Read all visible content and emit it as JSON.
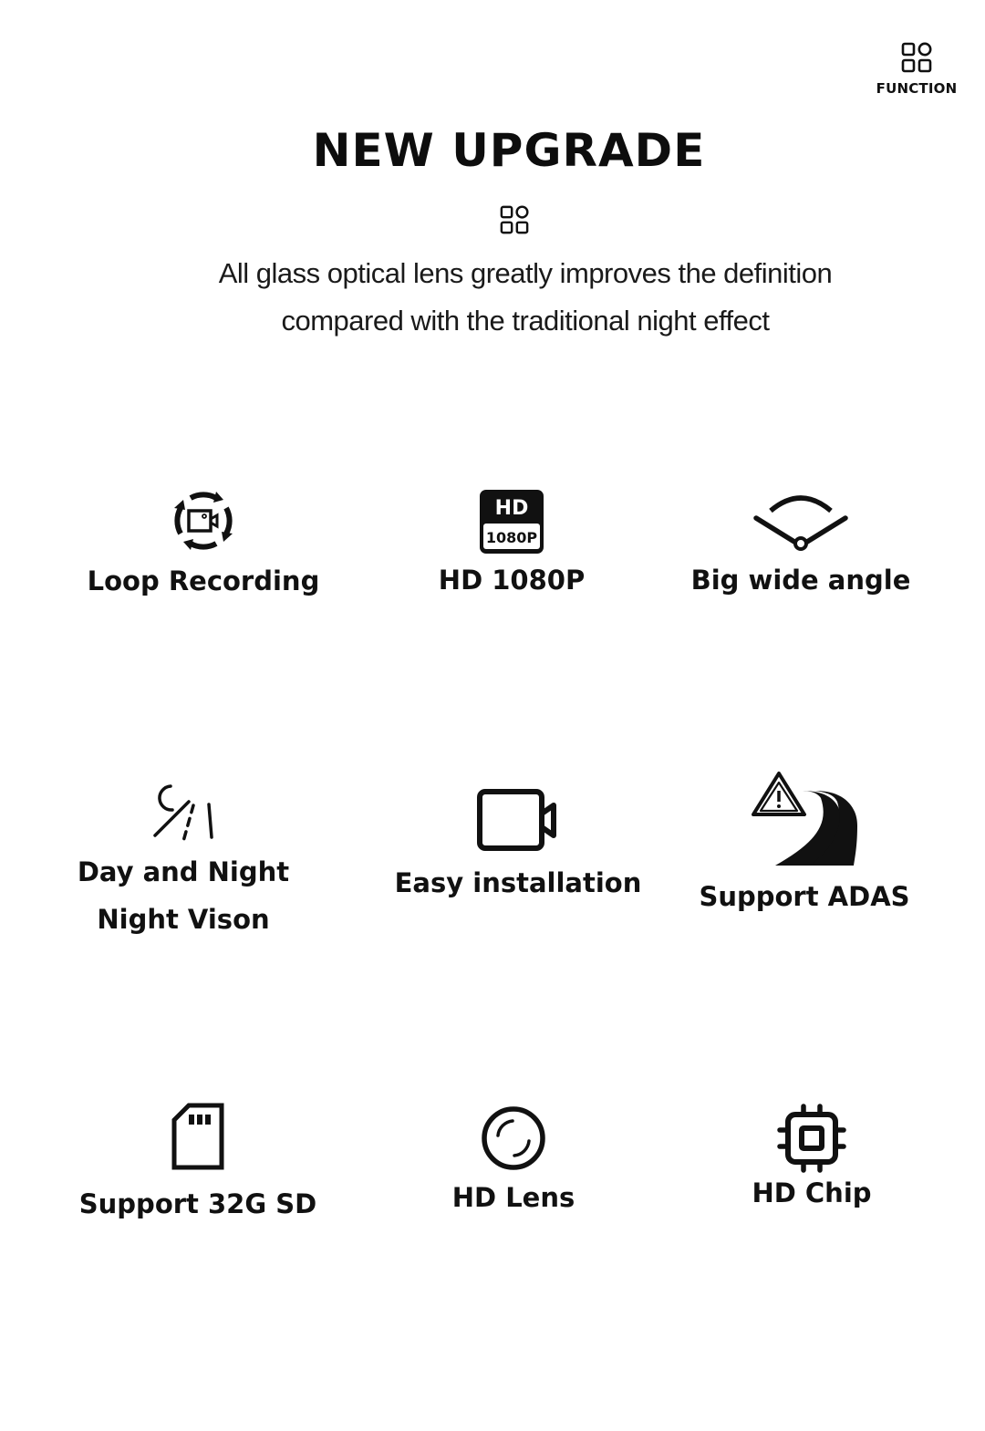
{
  "header": {
    "function_label": "FUNCTION",
    "function_icon": "grid-icon",
    "title": "NEW UPGRADE",
    "title_icon": "grid-icon",
    "subtitle_line1": "All glass optical lens greatly improves the definition",
    "subtitle_line2": "compared with the traditional night effect"
  },
  "features": [
    {
      "label": "Loop Recording",
      "icon": "loop-recording-icon"
    },
    {
      "label": "HD 1080P",
      "icon": "hd-1080p-icon",
      "badge_top": "HD",
      "badge_bottom": "1080P"
    },
    {
      "label": "Big wide angle",
      "icon": "wide-angle-icon"
    },
    {
      "label_line1": "Day and Night",
      "label_line2": "Night Vison",
      "icon": "day-night-icon"
    },
    {
      "label": "Easy installation",
      "icon": "video-camera-icon"
    },
    {
      "label": "Support ADAS",
      "icon": "adas-road-warning-icon"
    },
    {
      "label": "Support 32G SD",
      "icon": "sd-card-icon"
    },
    {
      "label": "HD Lens",
      "icon": "lens-icon"
    },
    {
      "label": "HD Chip",
      "icon": "chip-icon"
    }
  ],
  "colors": {
    "text": "#111111",
    "background": "#ffffff"
  }
}
